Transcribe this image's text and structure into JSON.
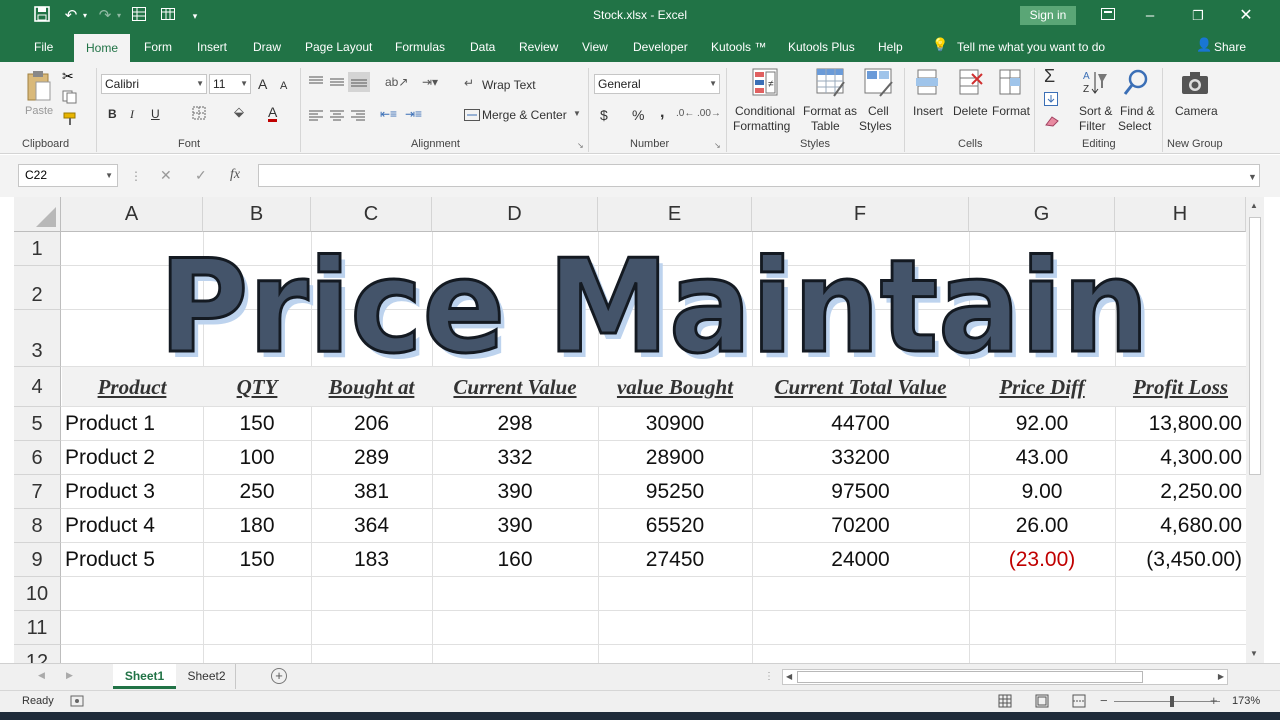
{
  "title_bar": {
    "document_title": "Stock.xlsx  -  Excel",
    "sign_in": "Sign in"
  },
  "tabs": [
    {
      "label": "File"
    },
    {
      "label": "Home"
    },
    {
      "label": "Form"
    },
    {
      "label": "Insert"
    },
    {
      "label": "Draw"
    },
    {
      "label": "Page Layout"
    },
    {
      "label": "Formulas"
    },
    {
      "label": "Data"
    },
    {
      "label": "Review"
    },
    {
      "label": "View"
    },
    {
      "label": "Developer"
    },
    {
      "label": "Kutools ™"
    },
    {
      "label": "Kutools Plus"
    },
    {
      "label": "Help"
    }
  ],
  "tell_me": "Tell me what you want to do",
  "share": "Share",
  "ribbon": {
    "clipboard": {
      "label": "Clipboard",
      "paste": "Paste"
    },
    "font": {
      "label": "Font",
      "name": "Calibri",
      "size": "11",
      "bold": "B",
      "italic": "I",
      "underline": "U",
      "grow": "A",
      "shrink": "A",
      "color": "A"
    },
    "alignment": {
      "label": "Alignment",
      "wrap": "Wrap Text",
      "merge": "Merge & Center"
    },
    "number": {
      "label": "Number",
      "format": "General",
      "currency": "$",
      "percent": "%",
      "comma": ","
    },
    "styles": {
      "label": "Styles",
      "conditional_1": "Conditional",
      "conditional_2": "Formatting",
      "table_1": "Format as",
      "table_2": "Table",
      "cell_1": "Cell",
      "cell_2": "Styles"
    },
    "cells": {
      "label": "Cells",
      "insert": "Insert",
      "delete": "Delete",
      "format": "Format"
    },
    "editing": {
      "label": "Editing",
      "sort_1": "Sort &",
      "sort_2": "Filter",
      "find_1": "Find &",
      "find_2": "Select"
    },
    "newgroup": {
      "label": "New Group",
      "camera": "Camera"
    }
  },
  "name_box": "C22",
  "fx": "fx",
  "columns": [
    "A",
    "B",
    "C",
    "D",
    "E",
    "F",
    "G",
    "H"
  ],
  "rows": [
    "1",
    "2",
    "3",
    "4",
    "5",
    "6",
    "7",
    "8",
    "9",
    "10",
    "11",
    "12"
  ],
  "banner_title": "Price Maintain",
  "headers": [
    "Product",
    "QTY",
    "Bought at",
    "Current Value",
    "value Bought",
    "Current Total Value",
    "Price Diff",
    "Profit Loss"
  ],
  "table": [
    [
      "Product 1",
      "150",
      "206",
      "298",
      "30900",
      "44700",
      "92.00",
      "13,800.00"
    ],
    [
      "Product 2",
      "100",
      "289",
      "332",
      "28900",
      "33200",
      "43.00",
      "4,300.00"
    ],
    [
      "Product 3",
      "250",
      "381",
      "390",
      "95250",
      "97500",
      "9.00",
      "2,250.00"
    ],
    [
      "Product 4",
      "180",
      "364",
      "390",
      "65520",
      "70200",
      "26.00",
      "4,680.00"
    ],
    [
      "Product 5",
      "150",
      "183",
      "160",
      "27450",
      "24000",
      "(23.00)",
      "(3,450.00)"
    ]
  ],
  "sheets": [
    {
      "label": "Sheet1"
    },
    {
      "label": "Sheet2"
    }
  ],
  "status": {
    "ready": "Ready",
    "zoom": "173%"
  },
  "colors": {
    "excel_green": "#217346",
    "banner_fill": "#44546a",
    "negative": "#c00000"
  }
}
